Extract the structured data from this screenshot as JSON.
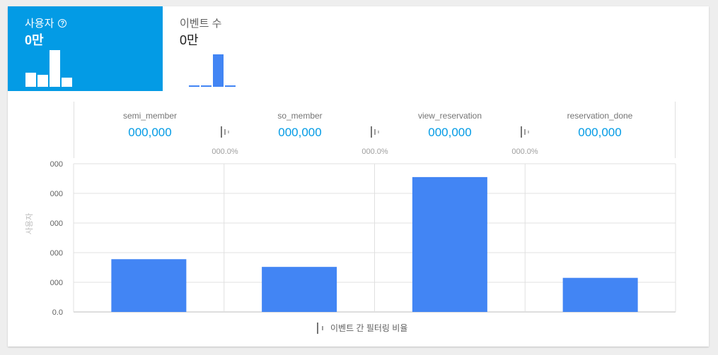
{
  "tabs": {
    "users": {
      "label": "사용자",
      "value": "0만",
      "spark_levels": [
        0.38,
        0.33,
        1.0,
        0.25
      ]
    },
    "events": {
      "label": "이벤트 수",
      "value": "0만",
      "spark_levels": [
        0.04,
        0.02,
        1.0,
        0.04
      ]
    }
  },
  "funnel": {
    "steps": [
      {
        "name": "semi_member",
        "value": "000,000"
      },
      {
        "name": "so_member",
        "value": "000,000"
      },
      {
        "name": "view_reservation",
        "value": "000,000"
      },
      {
        "name": "reservation_done",
        "value": "000,000"
      }
    ],
    "conversion_rates": [
      "000.0%",
      "000.0%",
      "000.0%"
    ]
  },
  "chart_data": {
    "type": "bar",
    "categories": [
      "semi_member",
      "so_member",
      "view_reservation",
      "reservation_done"
    ],
    "values": [
      1.78,
      1.52,
      4.55,
      1.15
    ],
    "ylim": [
      0,
      5
    ],
    "ytick_labels": [
      "0.0",
      "000",
      "000",
      "000",
      "000",
      "000"
    ],
    "ylabel": "사용자",
    "bar_color": "#4285f4",
    "grid": true
  },
  "legend": {
    "label": "이벤트 간 필터링 비율"
  },
  "colors": {
    "accent": "#039be5",
    "bar": "#4285f4"
  }
}
